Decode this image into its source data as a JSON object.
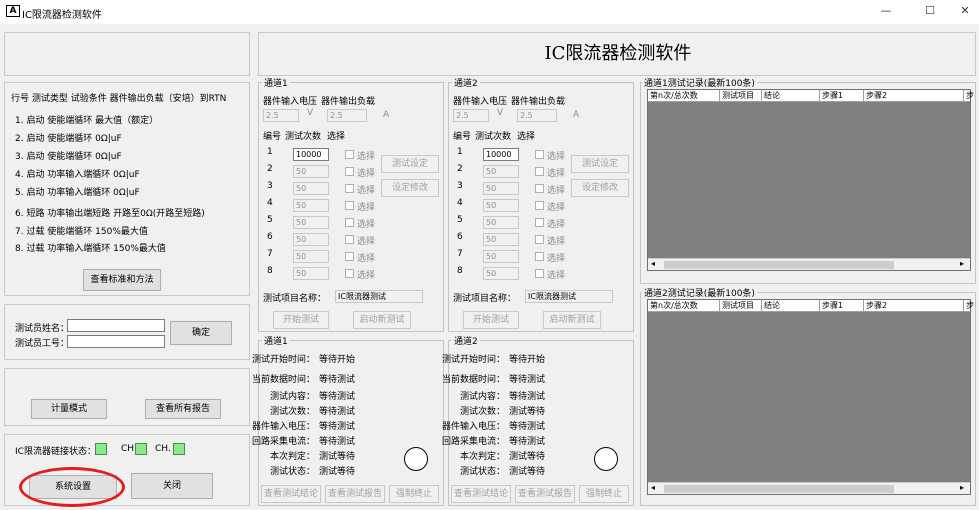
{
  "window": {
    "icon_glyph": "A",
    "title": "IC限流器检测软件",
    "minimize": "—",
    "maximize": "☐",
    "close": "✕"
  },
  "banner": {
    "title": "IC限流器检测软件"
  },
  "standards": {
    "header": "行号  测试类型  试验条件    器件输出负载（安培）到RTN",
    "rows": [
      "1.  启动      使能端循环        最大值（额定）",
      "2.  启动      使能端循环        0Ω|uF",
      "3.  启动      使能端循环        0Ω|uF",
      "4.  启动      功率输入端循环    0Ω|uF",
      "5.  启动      功率输入端循环    0Ω|uF",
      "6.  短路      功率输出端短路  开路至0Ω(开路至短路)",
      "7.  过载      使能端循环        150%最大值",
      "8.  过载  功率输入端循环      150%最大值"
    ],
    "button": "查看标准和方法"
  },
  "tester": {
    "name_label": "测试员姓名：",
    "id_label": "测试员工号：",
    "name_value": "",
    "id_value": "",
    "confirm": "确定"
  },
  "modes": {
    "metering": "计量模式",
    "all_reports": "查看所有报告"
  },
  "status": {
    "link_label": "IC限流器链接状态：",
    "ch1": "CH",
    "ch2": "CH.",
    "settings": "系统设置",
    "close": "关闭",
    "led_color": "#8ce88c",
    "highlight_color": "#e02020"
  },
  "channels": [
    {
      "title": "通道1",
      "voltage_label": "器件输入电压",
      "load_label": "器件输出负载",
      "voltage": "2.5",
      "v_unit": "V",
      "load": "2.5",
      "a_unit": "A",
      "col_no": "编号",
      "col_count": "测试次数",
      "col_select": "选择",
      "rows": [
        {
          "no": "1",
          "count": "10000",
          "select": "选择"
        },
        {
          "no": "2",
          "count": "50",
          "select": "选择"
        },
        {
          "no": "3",
          "count": "50",
          "select": "选择"
        },
        {
          "no": "4",
          "count": "50",
          "select": "选择"
        },
        {
          "no": "5",
          "count": "50",
          "select": "选择"
        },
        {
          "no": "6",
          "count": "50",
          "select": "选择"
        },
        {
          "no": "7",
          "count": "50",
          "select": "选择"
        },
        {
          "no": "8",
          "count": "50",
          "select": "选择"
        }
      ],
      "btn_test_set": "测试设定",
      "btn_set_modify": "设定修改",
      "project_label": "测试项目名称：",
      "project_value": "IC限流器测试",
      "btn_start": "开始测试",
      "btn_restart": "启动新测试",
      "status_title": "通道1",
      "status_rows": [
        {
          "label": "测试开始时间：",
          "value": "等待开始"
        },
        {
          "label": "当前数据时间：",
          "value": "等待测试"
        },
        {
          "label": "测试内容：",
          "value": "等待测试"
        },
        {
          "label": "测试次数：",
          "value": "等待测试"
        },
        {
          "label": "器件输入电压：",
          "value": "等待测试"
        },
        {
          "label": "回路采集电流：",
          "value": "等待测试"
        },
        {
          "label": "本次判定：",
          "value": "测试等待"
        },
        {
          "label": "测试状态：",
          "value": "测试等待"
        }
      ],
      "btn_view_result": "查看测试结论",
      "btn_view_report": "查看测试报告",
      "btn_force_stop": "强制终止"
    },
    {
      "title": "通道2",
      "voltage_label": "器件输入电压",
      "load_label": "器件输出负载",
      "voltage": "2.5",
      "v_unit": "V",
      "load": "2.5",
      "a_unit": "A",
      "col_no": "编号",
      "col_count": "测试次数",
      "col_select": "选择",
      "rows": [
        {
          "no": "1",
          "count": "10000",
          "select": "选择"
        },
        {
          "no": "2",
          "count": "50",
          "select": "选择"
        },
        {
          "no": "3",
          "count": "50",
          "select": "选择"
        },
        {
          "no": "4",
          "count": "50",
          "select": "选择"
        },
        {
          "no": "5",
          "count": "50",
          "select": "选择"
        },
        {
          "no": "6",
          "count": "50",
          "select": "选择"
        },
        {
          "no": "7",
          "count": "50",
          "select": "选择"
        },
        {
          "no": "8",
          "count": "50",
          "select": "选择"
        }
      ],
      "btn_test_set": "测试设定",
      "btn_set_modify": "设定修改",
      "project_label": "测试项目名称：",
      "project_value": "IC限流器测试",
      "btn_start": "开始测试",
      "btn_restart": "启动新测试",
      "status_title": "通道2",
      "status_rows": [
        {
          "label": "测试开始时间：",
          "value": "等待开始"
        },
        {
          "label": "当前数据时间：",
          "value": "等待测试"
        },
        {
          "label": "测试内容：",
          "value": "等待测试"
        },
        {
          "label": "测试次数：",
          "value": "测试等待"
        },
        {
          "label": "器件输入电压：",
          "value": "等待测试"
        },
        {
          "label": "回路采集电流：",
          "value": "等待测试"
        },
        {
          "label": "本次判定：",
          "value": "测试等待"
        },
        {
          "label": "测试状态：",
          "value": "测试等待"
        }
      ],
      "btn_view_result": "查看测试结论",
      "btn_view_report": "查看测试报告",
      "btn_force_stop": "强制终止"
    }
  ],
  "records": [
    {
      "title": "通道1测试记录(最新100条)",
      "columns": [
        "第n次/总次数",
        "测试项目",
        "结论",
        "步骤1",
        "步骤2",
        "步"
      ],
      "scroll_left": "◂",
      "scroll_right": "▸"
    },
    {
      "title": "通道2测试记录(最新100条)",
      "columns": [
        "第n次/总次数",
        "测试项目",
        "结论",
        "步骤1",
        "步骤2",
        "步"
      ],
      "scroll_left": "◂",
      "scroll_right": "▸"
    }
  ]
}
